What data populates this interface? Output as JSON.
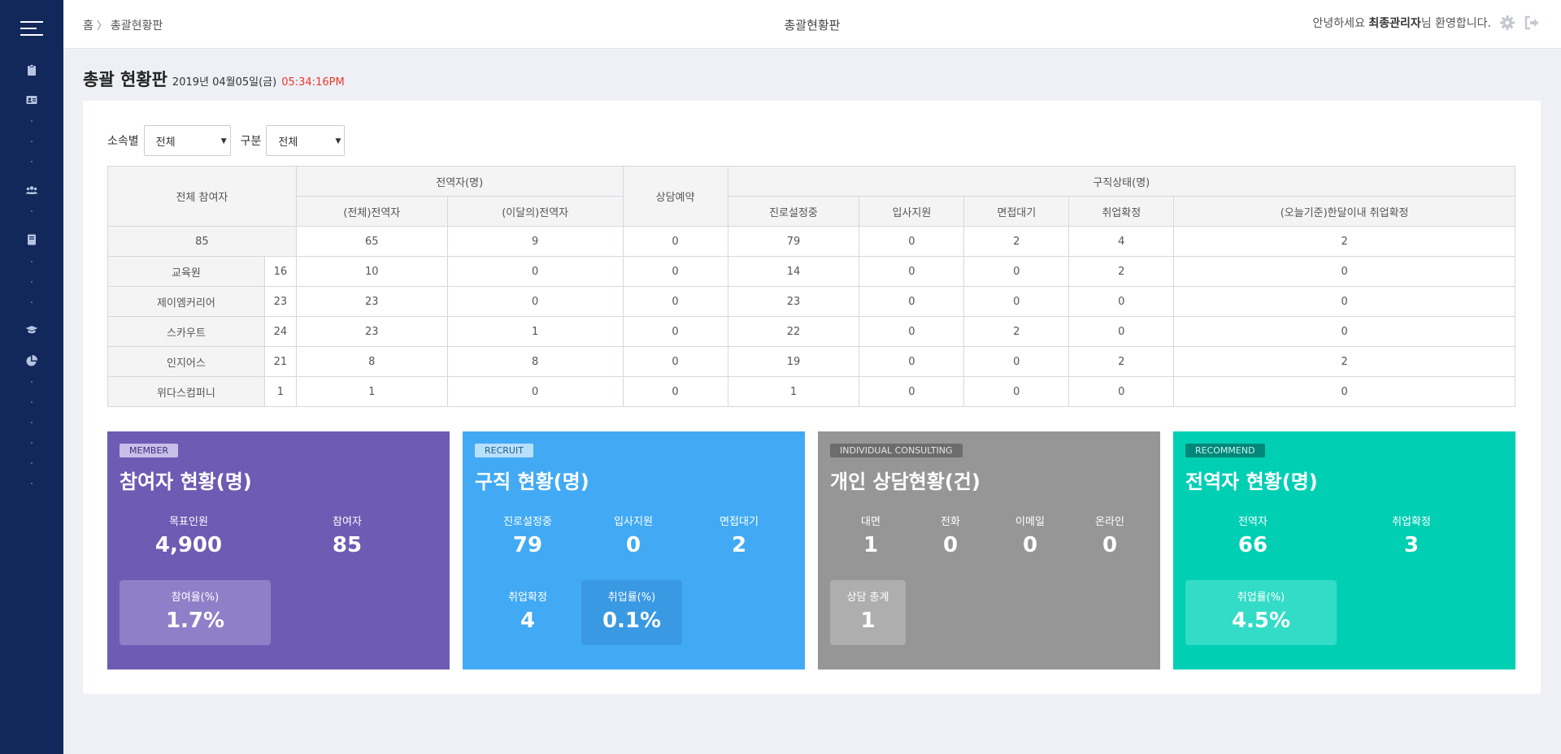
{
  "breadcrumb": {
    "home": "홈",
    "current": "총괄현황판"
  },
  "topbar": {
    "title": "총괄현황판",
    "greeting_prefix": "안녕하세요 ",
    "user_name": "최종관리자",
    "greeting_suffix": "님 환영합니다."
  },
  "page": {
    "title": "총괄 현황판",
    "date": "2019년 04월05일(금)",
    "time": "05:34:16PM"
  },
  "filters": {
    "affiliation_label": "소속별",
    "affiliation_value": "전체",
    "category_label": "구분",
    "category_value": "전체"
  },
  "table": {
    "head": {
      "total_participants": "전체 참여자",
      "discharged_group": "전역자(명)",
      "consult_booking": "상담예약",
      "job_status_group": "구직상태(명)",
      "total_discharged": "(전체)전역자",
      "month_discharged": "(이달의)전역자",
      "career_setting": "진로설정중",
      "applied": "입사지원",
      "interview_wait": "면접대기",
      "employed": "취업확정",
      "month_employed": "(오늘기준)한달이내 취업확정"
    },
    "total_row": [
      "85",
      "65",
      "9",
      "0",
      "79",
      "0",
      "2",
      "4",
      "2"
    ],
    "rows": [
      {
        "name": "교육원",
        "count": "16",
        "values": [
          "10",
          "0",
          "0",
          "14",
          "0",
          "0",
          "2",
          "0"
        ]
      },
      {
        "name": "제이엠커리어",
        "count": "23",
        "values": [
          "23",
          "0",
          "0",
          "23",
          "0",
          "0",
          "0",
          "0"
        ]
      },
      {
        "name": "스카우트",
        "count": "24",
        "values": [
          "23",
          "1",
          "0",
          "22",
          "0",
          "2",
          "0",
          "0"
        ]
      },
      {
        "name": "인지어스",
        "count": "21",
        "values": [
          "8",
          "8",
          "0",
          "19",
          "0",
          "0",
          "2",
          "2"
        ]
      },
      {
        "name": "위다스컴퍼니",
        "count": "1",
        "values": [
          "1",
          "0",
          "0",
          "1",
          "0",
          "0",
          "0",
          "0"
        ]
      }
    ]
  },
  "cards": {
    "member": {
      "tag": "MEMBER",
      "title": "참여자 현황(명)",
      "color": "#6d5bb4",
      "target_label": "목표인원",
      "target_value": "4,900",
      "participants_label": "참여자",
      "participants_value": "85",
      "rate_label": "참여율(%)",
      "rate_value": "1.7%"
    },
    "recruit": {
      "tag": "RECRUIT",
      "title": "구직 현황(명)",
      "color": "#42aaf4",
      "career_label": "진로설정중",
      "career_value": "79",
      "applied_label": "입사지원",
      "applied_value": "0",
      "interview_label": "면접대기",
      "interview_value": "2",
      "employed_label": "취업확정",
      "employed_value": "4",
      "rate_label": "취업률(%)",
      "rate_value": "0.1%"
    },
    "consulting": {
      "tag": "INDIVIDUAL CONSULTING",
      "title": "개인 상담현황(건)",
      "color": "#969696",
      "face_label": "대면",
      "face_value": "1",
      "phone_label": "전화",
      "phone_value": "0",
      "email_label": "이메일",
      "email_value": "0",
      "online_label": "온라인",
      "online_value": "0",
      "total_label": "상담 총계",
      "total_value": "1"
    },
    "recommend": {
      "tag": "RECOMMEND",
      "title": "전역자 현황(명)",
      "color": "#00cfb4",
      "discharged_label": "전역자",
      "discharged_value": "66",
      "employed_label": "취업확정",
      "employed_value": "3",
      "rate_label": "취업률(%)",
      "rate_value": "4.5%"
    }
  },
  "icons": {
    "sidebar": [
      "menu-icon",
      "clipboard-icon",
      "id-card-icon",
      "users-icon",
      "book-icon",
      "graduation-cap-icon",
      "pie-chart-icon"
    ],
    "topbar": [
      "gear-icon",
      "logout-icon"
    ]
  }
}
